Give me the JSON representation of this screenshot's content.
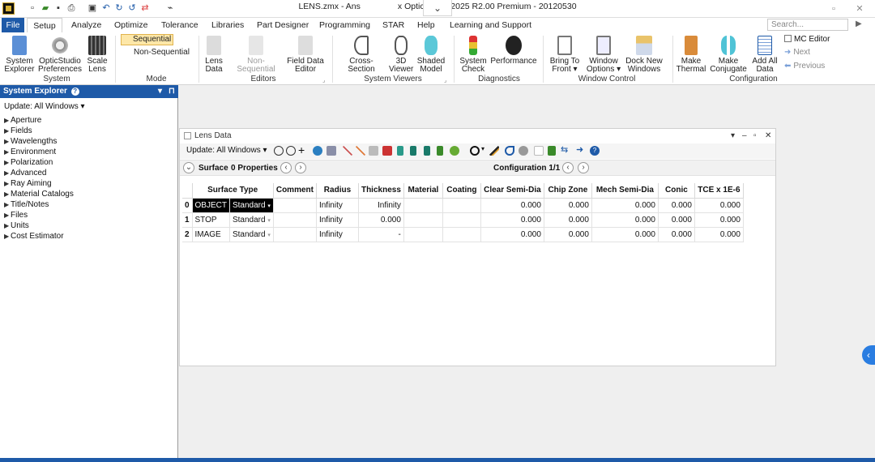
{
  "window": {
    "title": "LENS.zmx - Ansys Zemax OpticStudio 2025 R2.00   Premium - 20120530",
    "title_left": "LENS.zmx - Ans",
    "title_right": "x OpticStudio 2025 R2.00   Premium - 20120530",
    "chevron": "⌄"
  },
  "menu": {
    "file": "File",
    "items": [
      "Setup",
      "Analyze",
      "Optimize",
      "Tolerance",
      "Libraries",
      "Part Designer",
      "Programming",
      "STAR",
      "Help",
      "Learning and Support"
    ],
    "search_placeholder": "Search..."
  },
  "ribbon": {
    "system_explorer": [
      "System",
      "Explorer"
    ],
    "opticstudio_prefs": [
      "OpticStudio",
      "Preferences"
    ],
    "scale_lens": [
      "Scale",
      "Lens"
    ],
    "sequential": "Sequential",
    "non_sequential": "Non-Sequential",
    "lens_data": [
      "Lens",
      "Data"
    ],
    "non_seq_editor": "Non-Sequential",
    "field_data_editor": [
      "Field Data",
      "Editor"
    ],
    "cross_section": "Cross-Section",
    "viewer3d": [
      "3D",
      "Viewer"
    ],
    "shaded_model": [
      "Shaded",
      "Model"
    ],
    "system_check": [
      "System",
      "Check"
    ],
    "performance": "Performance",
    "bring_to_front": [
      "Bring To",
      "Front ▾"
    ],
    "window_options": [
      "Window",
      "Options ▾"
    ],
    "dock_new_windows": [
      "Dock New",
      "Windows"
    ],
    "make_thermal": [
      "Make",
      "Thermal"
    ],
    "make_conjugate": [
      "Make",
      "Conjugate"
    ],
    "add_all_data": [
      "Add All",
      "Data"
    ],
    "mc_editor": "MC Editor",
    "next": "Next",
    "previous": "Previous",
    "groups": {
      "system": "System",
      "mode": "Mode",
      "editors": "Editors",
      "system_viewers": "System Viewers",
      "diagnostics": "Diagnostics",
      "window_control": "Window Control",
      "configuration": "Configuration"
    }
  },
  "system_explorer": {
    "header": "System Explorer",
    "update": "Update: All Windows ▾",
    "items": [
      "Aperture",
      "Fields",
      "Wavelengths",
      "Environment",
      "Polarization",
      "Advanced",
      "Ray Aiming",
      "Material Catalogs",
      "Title/Notes",
      "Files",
      "Units",
      "Cost Estimator"
    ]
  },
  "lens_data": {
    "title": "Lens Data",
    "update": "Update: All Windows ▾",
    "surface_type_label": "Surface Type",
    "surface": "Surface",
    "properties": "0 Properties",
    "configuration": "Configuration 1/1",
    "columns": [
      "Surface Type",
      "Comment",
      "Radius",
      "Thickness",
      "Material",
      "Coating",
      "Clear Semi-Dia",
      "Chip Zone",
      "Mech Semi-Dia",
      "Conic",
      "TCE x 1E-6"
    ],
    "rows": [
      {
        "num": "0",
        "name": "OBJECT",
        "type": "Standard",
        "comment": "",
        "radius": "Infinity",
        "thickness": "Infinity",
        "material": "",
        "coating": "",
        "clear": "0.000",
        "chip": "0.000",
        "mech": "0.000",
        "conic": "0.000",
        "tce": "0.000"
      },
      {
        "num": "1",
        "name": "STOP",
        "type": "Standard",
        "comment": "",
        "radius": "Infinity",
        "thickness": "0.000",
        "material": "",
        "coating": "",
        "clear": "0.000",
        "chip": "0.000",
        "mech": "0.000",
        "conic": "0.000",
        "tce": "0.000"
      },
      {
        "num": "2",
        "name": "IMAGE",
        "type": "Standard",
        "comment": "",
        "radius": "Infinity",
        "thickness": "-",
        "material": "",
        "coating": "",
        "clear": "0.000",
        "chip": "0.000",
        "mech": "0.000",
        "conic": "0.000",
        "tce": "0.000"
      }
    ]
  },
  "colors": {
    "accent": "#1e5aa8",
    "sequential_bg": "#fde7a8"
  }
}
